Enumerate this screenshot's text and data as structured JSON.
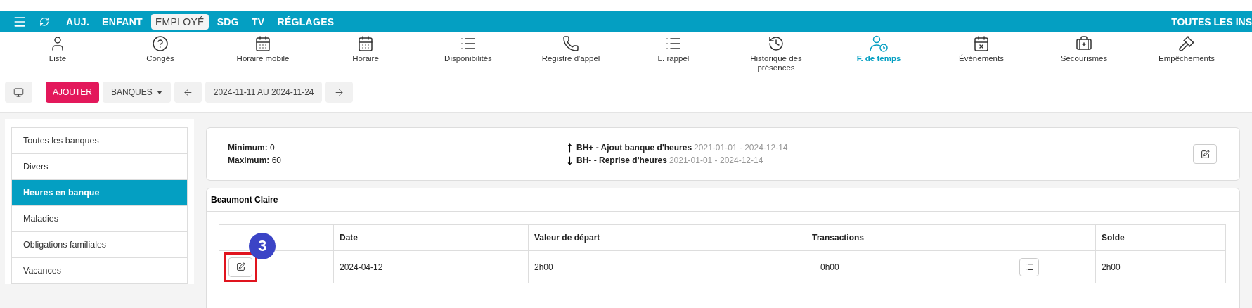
{
  "top_tabs": [
    {
      "label": "AUJ.",
      "selected": false
    },
    {
      "label": "ENFANT",
      "selected": false
    },
    {
      "label": "EMPLOYÉ",
      "selected": true
    },
    {
      "label": "SDG",
      "selected": false
    },
    {
      "label": "TV",
      "selected": false
    },
    {
      "label": "RÉGLAGES",
      "selected": false
    }
  ],
  "top_right": "TOUTES LES INS",
  "nav": [
    {
      "kind": "user",
      "label": "Liste",
      "selected": false
    },
    {
      "kind": "help",
      "label": "Congés",
      "selected": false
    },
    {
      "kind": "calendar",
      "label": "Horaire mobile",
      "selected": false
    },
    {
      "kind": "calendar",
      "label": "Horaire",
      "selected": false
    },
    {
      "kind": "list",
      "label": "Disponibilités",
      "selected": false
    },
    {
      "kind": "phone",
      "label": "Registre d'appel",
      "selected": false
    },
    {
      "kind": "list",
      "label": "L. rappel",
      "selected": false
    },
    {
      "kind": "history",
      "label": "Historique des présences",
      "selected": false
    },
    {
      "kind": "userclock",
      "label": "F. de temps",
      "selected": true
    },
    {
      "kind": "calendarx",
      "label": "Événements",
      "selected": false
    },
    {
      "kind": "firstaid",
      "label": "Secourismes",
      "selected": false
    },
    {
      "kind": "gavel",
      "label": "Empêchements",
      "selected": false
    }
  ],
  "toolbar": {
    "add": "AJOUTER",
    "dropdown": "BANQUES",
    "range": "2024-11-11 AU 2024-11-24"
  },
  "sidebar": [
    {
      "label": "Toutes les banques",
      "selected": false
    },
    {
      "label": "Divers",
      "selected": false
    },
    {
      "label": "Heures en banque",
      "selected": true
    },
    {
      "label": "Maladies",
      "selected": false
    },
    {
      "label": "Obligations familiales",
      "selected": false
    },
    {
      "label": "Vacances",
      "selected": false
    }
  ],
  "limits": [
    {
      "label": "Minimum:",
      "value": "0"
    },
    {
      "label": "Maximum:",
      "value": "60"
    }
  ],
  "bank_codes": [
    {
      "kind": "up",
      "code": "BH+",
      "name": "- Ajout banque d'heures",
      "dates": "2021-01-01 - 2024-12-14"
    },
    {
      "kind": "down",
      "code": "BH-",
      "name": "- Reprise d'heures",
      "dates": "2021-01-01 - 2024-12-14"
    }
  ],
  "employee": "Beaumont Claire",
  "table": {
    "columns": [
      "Date",
      "Valeur de départ",
      "Transactions",
      "Solde"
    ],
    "rows": [
      {
        "date": "2024-04-12",
        "start": "2h00",
        "transactions": "0h00",
        "balance": "2h00"
      }
    ]
  },
  "callout": "3"
}
